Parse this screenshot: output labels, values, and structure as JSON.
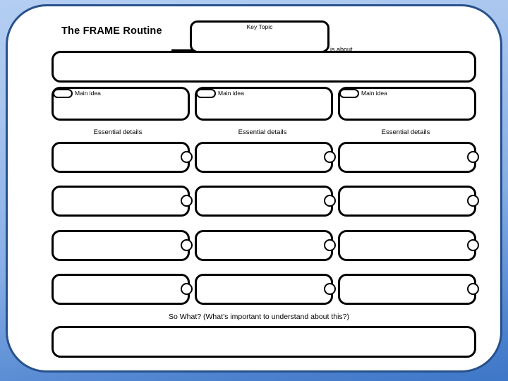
{
  "slide": {
    "title": "The FRAME Routine",
    "background_top_color": "#b4cef2",
    "background_bottom_color": "#3f77c8",
    "page_border_color": "#28518c",
    "ink_color": "#000000"
  },
  "key_topic": {
    "label": "Key Topic",
    "value": ""
  },
  "about": {
    "label": "is about…",
    "value": ""
  },
  "main_ideas": [
    {
      "label": "Main idea",
      "value": ""
    },
    {
      "label": "Main idea",
      "value": ""
    },
    {
      "label": "Main idea",
      "value": ""
    }
  ],
  "essential_details_headings": [
    "Essential details",
    "Essential details",
    "Essential details"
  ],
  "detail_rows": [
    [
      {
        "value": ""
      },
      {
        "value": ""
      },
      {
        "value": ""
      }
    ],
    [
      {
        "value": ""
      },
      {
        "value": ""
      },
      {
        "value": ""
      }
    ],
    [
      {
        "value": ""
      },
      {
        "value": ""
      },
      {
        "value": ""
      }
    ],
    [
      {
        "value": ""
      },
      {
        "value": ""
      },
      {
        "value": ""
      }
    ]
  ],
  "so_what": {
    "label": "So What? (What’s important to understand about this?)",
    "value": ""
  }
}
